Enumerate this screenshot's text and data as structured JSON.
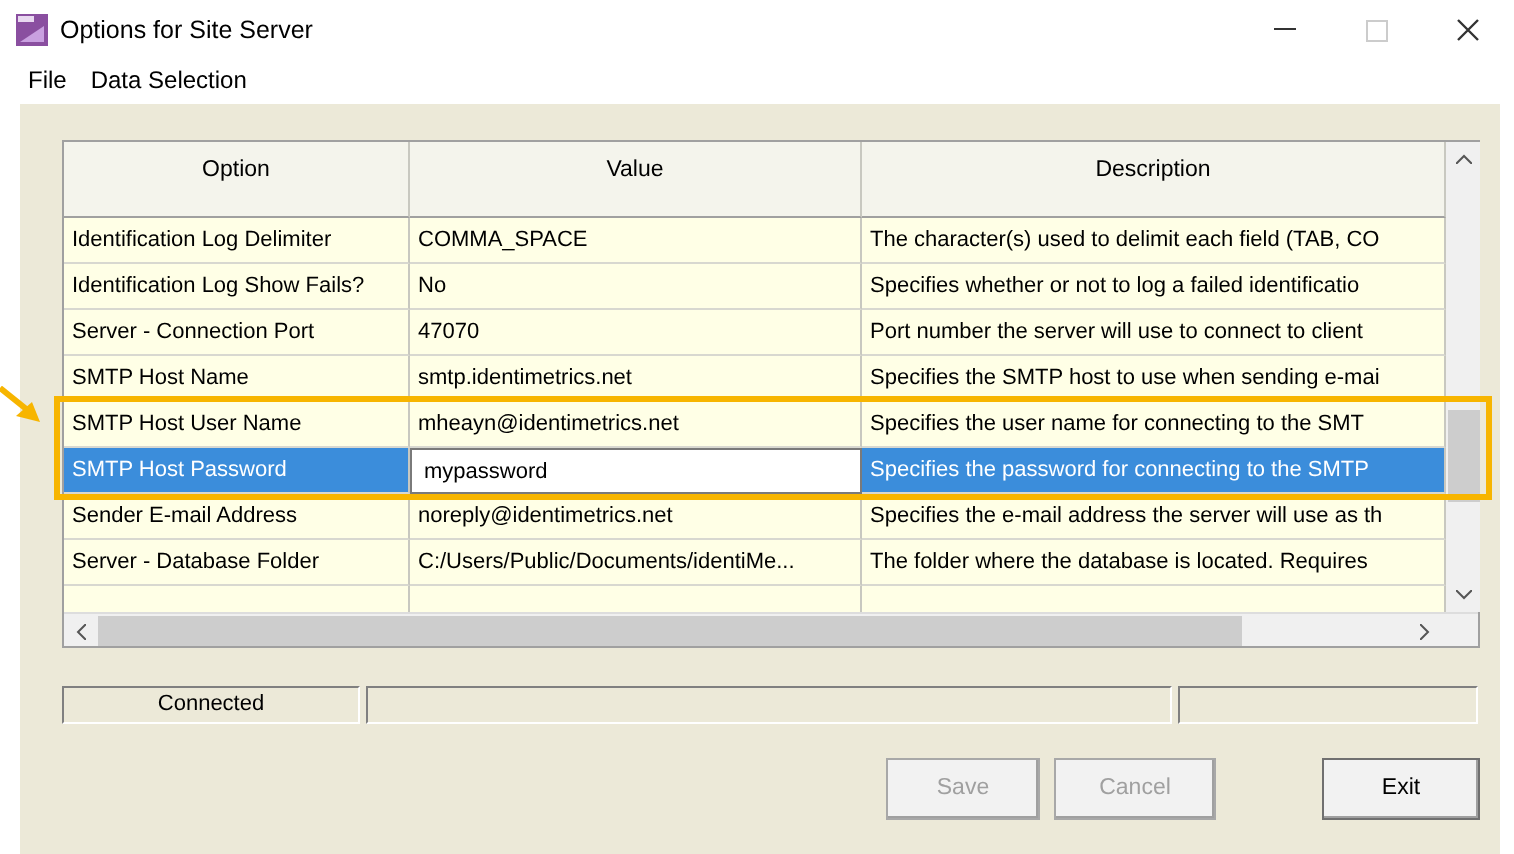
{
  "window": {
    "title": "Options for Site Server"
  },
  "menu": [
    "File",
    "Data Selection"
  ],
  "table": {
    "columns": [
      "Option",
      "Value",
      "Description"
    ],
    "rows": [
      {
        "option": "Identification Log Delimiter",
        "value": "COMMA_SPACE",
        "description": "The character(s) used to delimit each field (TAB, CO",
        "selected": false,
        "highlighted": false
      },
      {
        "option": "Identification Log Show Fails?",
        "value": "No",
        "description": "Specifies whether or not to log a failed identificatio",
        "selected": false,
        "highlighted": false
      },
      {
        "option": "Server - Connection Port",
        "value": "47070",
        "description": "Port number the server will use to connect to client",
        "selected": false,
        "highlighted": false
      },
      {
        "option": "SMTP Host Name",
        "value": "smtp.identimetrics.net",
        "description": "Specifies the SMTP host to use when sending e-mai",
        "selected": false,
        "highlighted": false
      },
      {
        "option": "SMTP Host User Name",
        "value": "mheayn@identimetrics.net",
        "description": "Specifies the user name for connecting to the SMT",
        "selected": false,
        "highlighted": true
      },
      {
        "option": "SMTP Host Password",
        "value": "mypassword",
        "description": "Specifies the password for connecting to the SMTP",
        "selected": true,
        "highlighted": true
      },
      {
        "option": "Sender E-mail Address",
        "value": "noreply@identimetrics.net",
        "description": "Specifies the e-mail address the server will use as th",
        "selected": false,
        "highlighted": false
      },
      {
        "option": "Server - Database Folder",
        "value": "C:/Users/Public/Documents/identiMe...",
        "description": "The folder where the database is located.  Requires",
        "selected": false,
        "highlighted": false
      }
    ]
  },
  "status_bar": {
    "connection": "Connected"
  },
  "buttons": [
    {
      "label": "Save",
      "disabled": true
    },
    {
      "label": "Cancel",
      "disabled": true
    },
    {
      "label": "Exit",
      "disabled": false
    }
  ]
}
